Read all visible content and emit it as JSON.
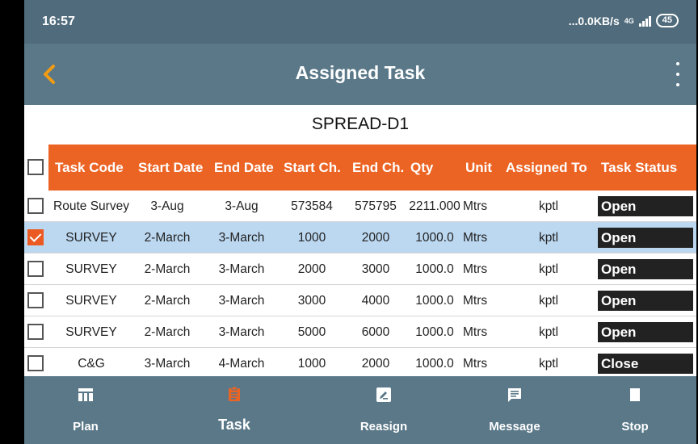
{
  "status_bar": {
    "time": "16:57",
    "net_speed": "...0.0KB/s",
    "network_type": "4G",
    "battery": "45"
  },
  "app_bar": {
    "title": "Assigned Task"
  },
  "spread_title": "SPREAD-D1",
  "table": {
    "headers": [
      "Task Code",
      "Start Date",
      "End Date",
      "Start Ch.",
      "End Ch.",
      "Qty",
      "Unit",
      "Assigned To",
      "Task Status"
    ],
    "rows": [
      {
        "checked": false,
        "cells": [
          "Route Survey",
          "3-Aug",
          "3-Aug",
          "573584",
          "575795",
          "2211.000",
          "Mtrs",
          "kptl",
          "Open"
        ]
      },
      {
        "checked": true,
        "cells": [
          "SURVEY",
          "2-March",
          "3-March",
          "1000",
          "2000",
          "1000.0",
          "Mtrs",
          "kptl",
          "Open"
        ]
      },
      {
        "checked": false,
        "cells": [
          "SURVEY",
          "2-March",
          "3-March",
          "2000",
          "3000",
          "1000.0",
          "Mtrs",
          "kptl",
          "Open"
        ]
      },
      {
        "checked": false,
        "cells": [
          "SURVEY",
          "2-March",
          "3-March",
          "3000",
          "4000",
          "1000.0",
          "Mtrs",
          "kptl",
          "Open"
        ]
      },
      {
        "checked": false,
        "cells": [
          "SURVEY",
          "2-March",
          "3-March",
          "5000",
          "6000",
          "1000.0",
          "Mtrs",
          "kptl",
          "Open"
        ]
      },
      {
        "checked": false,
        "cells": [
          "C&G",
          "3-March",
          "4-March",
          "1000",
          "2000",
          "1000.0",
          "Mtrs",
          "kptl",
          "Close"
        ]
      }
    ]
  },
  "bottom_nav": [
    {
      "label": "Plan",
      "icon": "table-icon",
      "active": false
    },
    {
      "label": "Task",
      "icon": "clipboard-icon",
      "active": true
    },
    {
      "label": "Reasign",
      "icon": "edit-icon",
      "active": false
    },
    {
      "label": "Message",
      "icon": "message-icon",
      "active": false
    },
    {
      "label": "Stop",
      "icon": "stop-icon",
      "active": false
    }
  ],
  "colors": {
    "status_bar": "#4f6b7c",
    "app_bar": "#5a7888",
    "header": "#ec6424",
    "accent": "#f39c12",
    "selected_row": "#bcd8f1",
    "status_cell": "#222222"
  }
}
